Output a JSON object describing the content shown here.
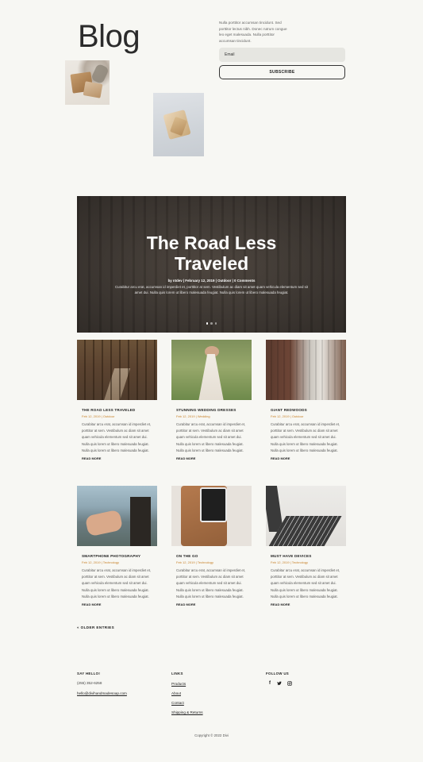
{
  "header": {
    "title": "Blog",
    "intro": "Nulla porttitor accumsan tincidunt. Sed porttitor lectus nibh. Donec rutrum congue leo eget malesuada. Nulla porttitor accumsan tincidunt.",
    "email_placeholder": "Email",
    "subscribe_label": "SUBSCRIBE"
  },
  "hero": {
    "title": "The Road Less Traveled",
    "meta": "by ntdev | February 12, 2019 | Outdoor | 0 Comments",
    "excerpt": "Curabitur arcu erat, accumsan id imperdiet et, porttitor at sem. Vestibulum ac diam sit amet quam vehicula elementum sed sit amet dui. Nulla quis lorem ut libero malesuada feugiat. Nulla quis lorem ut libero malesuada feugiat."
  },
  "posts": [
    {
      "title": "THE ROAD LESS TRAVELED",
      "meta": "Feb 12, 2019 | Outdoor",
      "excerpt": "Curabitur arcu erat, accumsan id imperdiet et, porttitor at sem. Vestibulum ac diam sit amet quam vehicula elementum sed sit amet dui. Nulla quis lorem ut libero malesuada feugiat. Nulla quis lorem ut libero malesuada feugiat.",
      "read_more": "READ MORE"
    },
    {
      "title": "STUNNING WEDDING DRESSES",
      "meta": "Feb 12, 2019 | Wedding",
      "excerpt": "Curabitur arcu erat, accumsan id imperdiet et, porttitor at sem. Vestibulum ac diam sit amet quam vehicula elementum sed sit amet dui. Nulla quis lorem ut libero malesuada feugiat. Nulla quis lorem ut libero malesuada feugiat.",
      "read_more": "READ MORE"
    },
    {
      "title": "GIANT REDWOODS",
      "meta": "Feb 12, 2019 | Outdoor",
      "excerpt": "Curabitur arcu erat, accumsan id imperdiet et, porttitor at sem. Vestibulum ac diam sit amet quam vehicula elementum sed sit amet dui. Nulla quis lorem ut libero malesuada feugiat. Nulla quis lorem ut libero malesuada feugiat.",
      "read_more": "READ MORE"
    },
    {
      "title": "SMARTPHONE PHOTOGRAPHY",
      "meta": "Feb 12, 2019 | Technology",
      "excerpt": "Curabitur arcu erat, accumsan id imperdiet et, porttitor at sem. Vestibulum ac diam sit amet quam vehicula elementum sed sit amet dui. Nulla quis lorem ut libero malesuada feugiat. Nulla quis lorem ut libero malesuada feugiat.",
      "read_more": "READ MORE"
    },
    {
      "title": "ON THE GO",
      "meta": "Feb 12, 2019 | Technology",
      "excerpt": "Curabitur arcu erat, accumsan id imperdiet et, porttitor at sem. Vestibulum ac diam sit amet quam vehicula elementum sed sit amet dui. Nulla quis lorem ut libero malesuada feugiat. Nulla quis lorem ut libero malesuada feugiat.",
      "read_more": "READ MORE"
    },
    {
      "title": "MUST HAVE DEVICES",
      "meta": "Feb 12, 2019 | Technology",
      "excerpt": "Curabitur arcu erat, accumsan id imperdiet et, porttitor at sem. Vestibulum ac diam sit amet quam vehicula elementum sed sit amet dui. Nulla quis lorem ut libero malesuada feugiat. Nulla quis lorem ut libero malesuada feugiat.",
      "read_more": "READ MORE"
    }
  ],
  "pagination": {
    "older_label": "« OLDER ENTRIES"
  },
  "footer": {
    "say_hello": {
      "heading": "SAY HELLO!",
      "phone": "(255) 352-6258",
      "email": "hello@divihandmadesoap.com"
    },
    "links": {
      "heading": "LINKS",
      "items": [
        "Products",
        "About",
        "Contact",
        "Shipping & Returns"
      ]
    },
    "follow": {
      "heading": "FOLLOW US",
      "icons": [
        "facebook-icon",
        "twitter-icon",
        "instagram-icon"
      ]
    },
    "copyright": "Copyright © 2022 Divi"
  },
  "colors": {
    "background": "#f7f7f3",
    "accent": "#c8822a",
    "text": "#222222"
  }
}
